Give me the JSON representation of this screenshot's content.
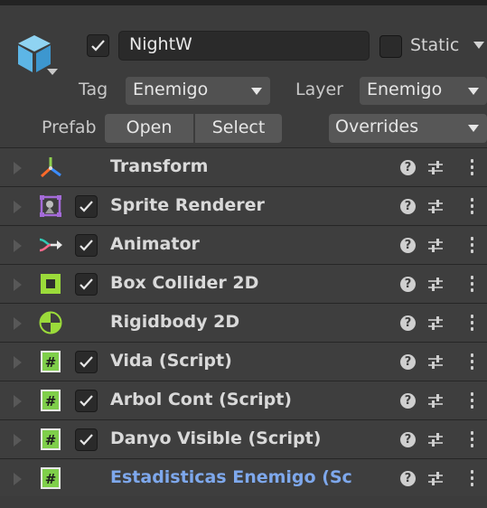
{
  "header": {
    "name": "NightW",
    "active_checked": true,
    "static_label": "Static",
    "static_checked": false,
    "tag_label": "Tag",
    "tag_value": "Enemigo",
    "layer_label": "Layer",
    "layer_value": "Enemigo",
    "prefab_label": "Prefab",
    "open_label": "Open",
    "select_label": "Select",
    "overrides_label": "Overrides"
  },
  "components": [
    {
      "label": "Transform",
      "icon": "transform-icon",
      "has_checkbox": false
    },
    {
      "label": "Sprite Renderer",
      "icon": "sprite-renderer-icon",
      "has_checkbox": true,
      "checked": true
    },
    {
      "label": "Animator",
      "icon": "animator-icon",
      "has_checkbox": true,
      "checked": true
    },
    {
      "label": "Box Collider 2D",
      "icon": "box-collider-icon",
      "has_checkbox": true,
      "checked": true
    },
    {
      "label": "Rigidbody 2D",
      "icon": "rigidbody-icon",
      "has_checkbox": false
    },
    {
      "label": "Vida (Script)",
      "icon": "script-icon",
      "has_checkbox": true,
      "checked": true
    },
    {
      "label": "Arbol Cont (Script)",
      "icon": "script-icon",
      "has_checkbox": true,
      "checked": true
    },
    {
      "label": "Danyo Visible (Script)",
      "icon": "script-icon",
      "has_checkbox": true,
      "checked": true
    },
    {
      "label": "Estadisticas Enemigo (Sc",
      "icon": "script-icon",
      "has_checkbox": false,
      "added_override": true
    }
  ],
  "row_help_glyph": "?",
  "colors": {
    "background": "#3c3c3c",
    "row_bg": "#3e3e3e",
    "override_label": "#7ea8ec",
    "cube_icon": "#6ec3ec",
    "collider_green": "#9bdb3a",
    "script_green": "#7fcf4a"
  }
}
